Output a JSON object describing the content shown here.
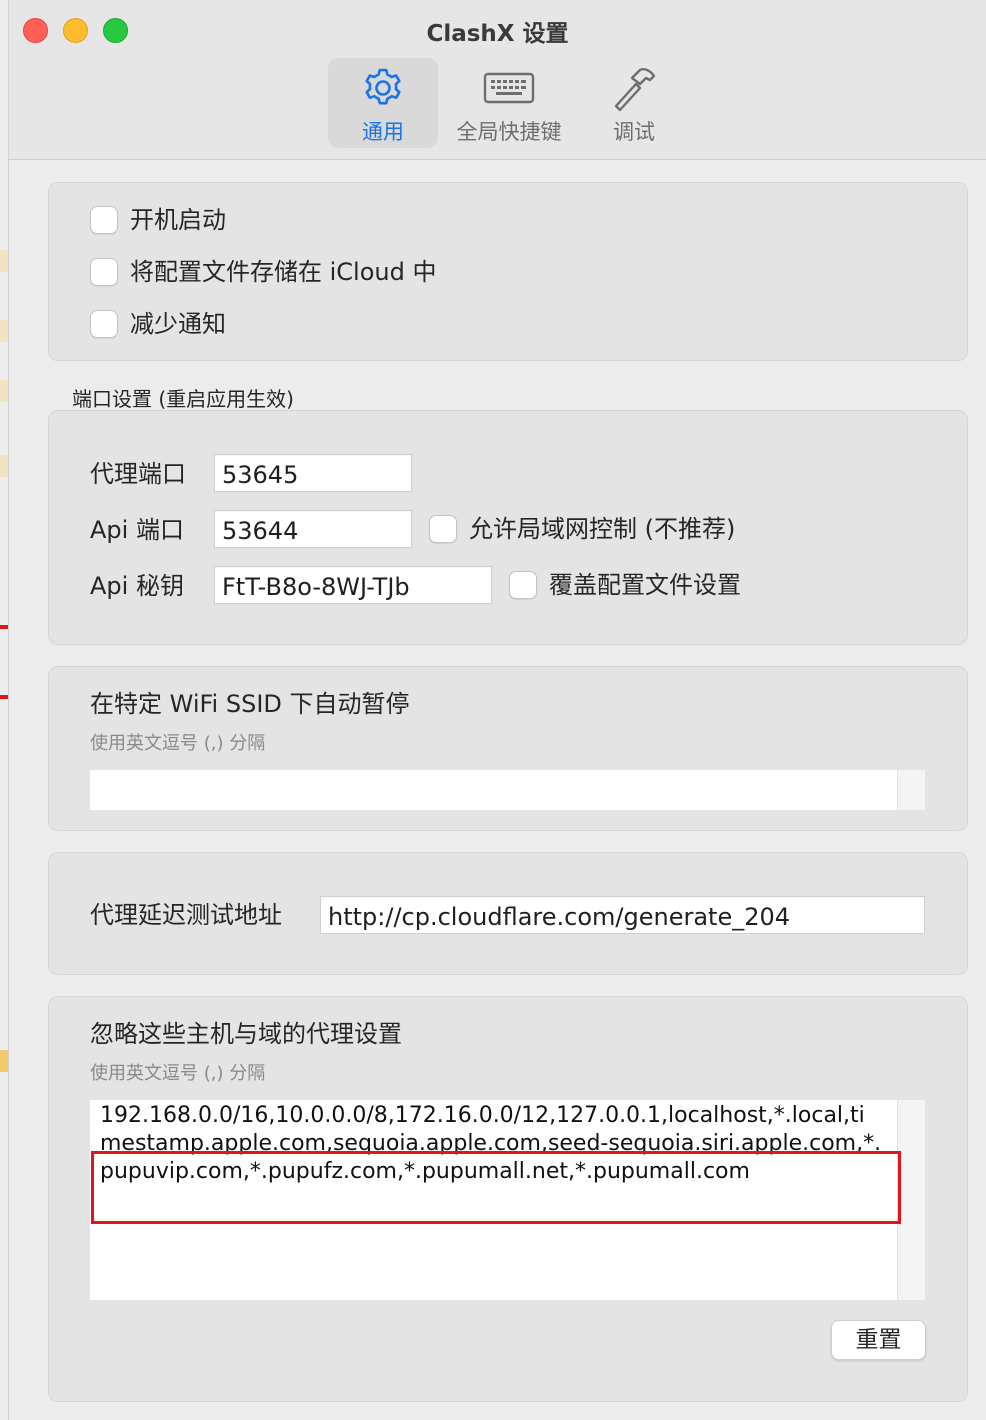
{
  "window": {
    "title": "ClashX 设置"
  },
  "tabs": [
    {
      "label": "通用",
      "icon": "gear-icon",
      "active": true
    },
    {
      "label": "全局快捷键",
      "icon": "keyboard-icon",
      "active": false
    },
    {
      "label": "调试",
      "icon": "hammer-icon",
      "active": false
    }
  ],
  "general": {
    "launch_at_login": {
      "label": "开机启动",
      "checked": false
    },
    "store_in_icloud": {
      "label": "将配置文件存储在 iCloud 中",
      "checked": false
    },
    "reduce_notifications": {
      "label": "减少通知",
      "checked": false
    }
  },
  "ports": {
    "section_title": "端口设置 (重启应用生效)",
    "proxy_port": {
      "label": "代理端口",
      "value": "53645"
    },
    "api_port": {
      "label": "Api 端口",
      "value": "53644"
    },
    "allow_lan": {
      "label": "允许局域网控制 (不推荐)",
      "checked": false
    },
    "api_secret": {
      "label": "Api 秘钥",
      "value": "FtT-B8o-8WJ-TJb"
    },
    "override_config": {
      "label": "覆盖配置文件设置",
      "checked": false
    }
  },
  "wifi": {
    "title": "在特定 WiFi SSID 下自动暂停",
    "hint": "使用英文逗号 (,) 分隔",
    "value": ""
  },
  "latency": {
    "label": "代理延迟测试地址",
    "value": "http://cp.cloudflare.com/generate_204"
  },
  "bypass": {
    "title": "忽略这些主机与域的代理设置",
    "hint": "使用英文逗号 (,) 分隔",
    "value": "192.168.0.0/16,10.0.0.0/8,172.16.0.0/12,127.0.0.1,localhost,*.local,timestamp.apple.com,sequoia.apple.com,seed-sequoia.siri.apple.com,*.pupuvip.com,*.pupufz.com,*.pupumall.net,*.pupumall.com",
    "reset_label": "重置"
  },
  "colors": {
    "accent": "#1a73e8",
    "highlight": "#e0161b"
  }
}
